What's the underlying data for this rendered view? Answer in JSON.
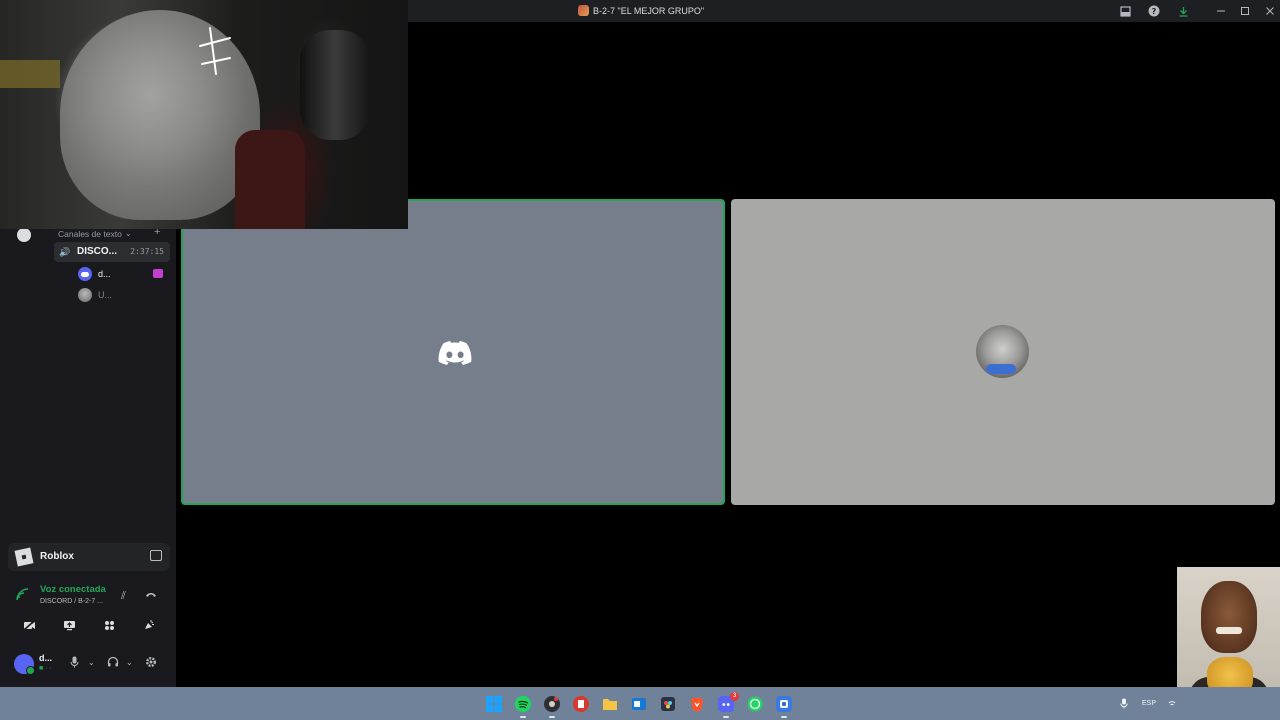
{
  "window": {
    "title": "B-2-7 \"EL MEJOR GRUPO\"",
    "controls": [
      "inbox-icon",
      "help-icon",
      "download-icon",
      "minimize-icon",
      "maximize-icon",
      "close-icon"
    ]
  },
  "sidebar": {
    "category_label": "Canales de texto",
    "voice_channel": {
      "name": "DISCO...",
      "elapsed": "2:37:15"
    },
    "members": [
      {
        "name": "d..."
      },
      {
        "name": "U..."
      }
    ]
  },
  "activity": {
    "game": "Roblox"
  },
  "voice_panel": {
    "status": "Voz conectada",
    "path": "DISCORD / B-2-7 ..."
  },
  "user_panel": {
    "name": "d...",
    "sub": "■ · ·"
  },
  "taskbar": {
    "apps": [
      "start-icon",
      "spotify-icon",
      "chrome-icon",
      "pdf-icon",
      "folder-icon",
      "outlook-icon",
      "davinci-icon",
      "brave-icon",
      "discord-icon",
      "whatsapp-icon",
      "discord-ptb-icon"
    ],
    "discord_badge": "3",
    "language": "ESP"
  },
  "colors": {
    "speaking_green": "#23a559",
    "discord_blurple": "#5865f2",
    "taskbar": "#6f829a"
  }
}
